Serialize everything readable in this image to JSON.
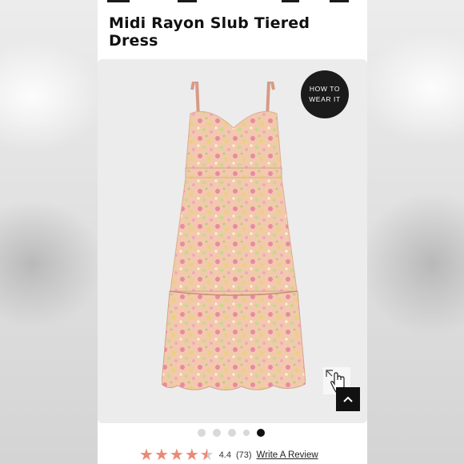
{
  "product": {
    "title_line1": "Midi Rayon Slub Tiered",
    "title_line2": "Dress"
  },
  "gallery": {
    "how_to_line1": "HOW TO",
    "how_to_line2": "WEAR IT",
    "dots_total": 5,
    "active_dot": 5
  },
  "rating": {
    "value": "4.4",
    "count": "(73)",
    "stars_filled": 4.4,
    "review_link": "Write A Review"
  },
  "colors": {
    "star": "#e98a77",
    "dress_base": "#f1c6a8",
    "accent_black": "#111111"
  }
}
